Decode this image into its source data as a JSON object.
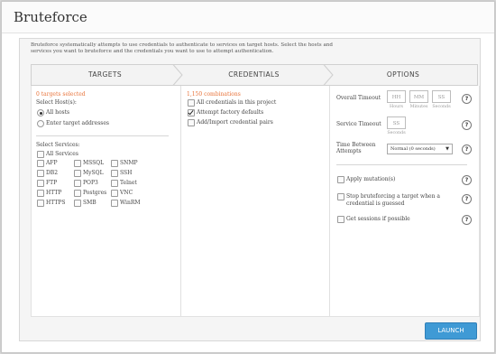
{
  "window": {
    "title": "Bruteforce"
  },
  "intro": "Bruteforce systematically attempts to use credentials to authenticate to services on target hosts. Select the hosts and services you want to bruteforce and the credentials you want to use to attempt authentication.",
  "steps": [
    "TARGETS",
    "CREDENTIALS",
    "OPTIONS"
  ],
  "targets": {
    "selected_count": "0 targets selected",
    "select_hosts_label": "Select Host(s):",
    "host_options": [
      "All hosts",
      "Enter target addresses"
    ],
    "selected_host_option": "All hosts",
    "select_services_label": "Select Services:",
    "all_services_label": "All Services",
    "services": [
      [
        "AFP",
        "MSSQL",
        "SNMP"
      ],
      [
        "DB2",
        "MySQL",
        "SSH"
      ],
      [
        "FTP",
        "POP3",
        "Telnet"
      ],
      [
        "HTTP",
        "Postgres",
        "VNC"
      ],
      [
        "HTTPS",
        "SMB",
        "WinRM"
      ]
    ]
  },
  "credentials": {
    "combinations": "1,150 combinations",
    "options": [
      {
        "label": "All credentials in this project",
        "checked": false
      },
      {
        "label": "Attempt factory defaults",
        "checked": true
      },
      {
        "label": "Add/Import credential pairs",
        "checked": false
      }
    ]
  },
  "options": {
    "overall_timeout_label": "Overall Timeout",
    "overall_timeout_fields": [
      {
        "placeholder": "HH",
        "unit": "Hours"
      },
      {
        "placeholder": "MM",
        "unit": "Minutes"
      },
      {
        "placeholder": "SS",
        "unit": "Seconds"
      }
    ],
    "service_timeout_label": "Service Timeout",
    "service_timeout_field": {
      "placeholder": "SS",
      "unit": "Seconds"
    },
    "time_between_label": "Time Between Attempts",
    "time_between_value": "Normal (0 seconds)",
    "checkboxes": [
      "Apply mutation(s)",
      "Stop bruteforcing a target when a credential is guessed",
      "Get sessions if possible"
    ],
    "help_symbol": "?"
  },
  "launch_label": "LAUNCH",
  "colors": {
    "accent_orange": "#e8733a",
    "launch_blue": "#3f9ad5"
  }
}
